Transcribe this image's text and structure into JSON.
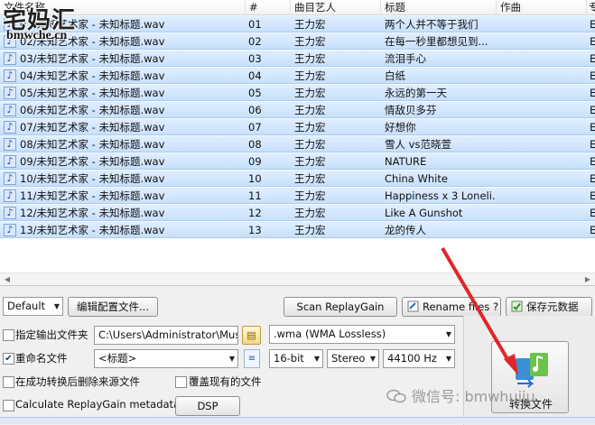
{
  "logo": {
    "main": "宅妈汇",
    "sub": "bmwche.cn"
  },
  "columns": {
    "file": "文件名称",
    "num": "#",
    "artist": "曲目艺人",
    "title": "标题",
    "composer": "作曲",
    "more": "专"
  },
  "rows": [
    {
      "file": "01/未知艺术家 - 未知标题.wav",
      "num": "01",
      "artist": "王力宏",
      "title": "两个人并不等于我们",
      "more": "E"
    },
    {
      "file": "02/未知艺术家 - 未知标题.wav",
      "num": "02",
      "artist": "王力宏",
      "title": "在每一秒里都想见到...",
      "more": "E"
    },
    {
      "file": "03/未知艺术家 - 未知标题.wav",
      "num": "03",
      "artist": "王力宏",
      "title": "流泪手心",
      "more": "E"
    },
    {
      "file": "04/未知艺术家 - 未知标题.wav",
      "num": "04",
      "artist": "王力宏",
      "title": "白纸",
      "more": "E"
    },
    {
      "file": "05/未知艺术家 - 未知标题.wav",
      "num": "05",
      "artist": "王力宏",
      "title": "永远的第一天",
      "more": "E"
    },
    {
      "file": "06/未知艺术家 - 未知标题.wav",
      "num": "06",
      "artist": "王力宏",
      "title": "情敌贝多芬",
      "more": "E"
    },
    {
      "file": "07/未知艺术家 - 未知标题.wav",
      "num": "07",
      "artist": "王力宏",
      "title": "好想你",
      "more": "E"
    },
    {
      "file": "08/未知艺术家 - 未知标题.wav",
      "num": "08",
      "artist": "王力宏",
      "title": "雪人 vs范晓萱",
      "more": "E"
    },
    {
      "file": "09/未知艺术家 - 未知标题.wav",
      "num": "09",
      "artist": "王力宏",
      "title": "NATURE",
      "more": "E"
    },
    {
      "file": "10/未知艺术家 - 未知标题.wav",
      "num": "10",
      "artist": "王力宏",
      "title": "China White",
      "more": "E"
    },
    {
      "file": "11/未知艺术家 - 未知标题.wav",
      "num": "11",
      "artist": "王力宏",
      "title": "Happiness x 3 Loneli...",
      "more": "E"
    },
    {
      "file": "12/未知艺术家 - 未知标题.wav",
      "num": "12",
      "artist": "王力宏",
      "title": "Like A Gunshot",
      "more": "E"
    },
    {
      "file": "13/未知艺术家 - 未知标题.wav",
      "num": "13",
      "artist": "王力宏",
      "title": "龙的传人",
      "more": "E"
    }
  ],
  "toolbar": {
    "profile_select": "Default",
    "edit_profile": "编辑配置文件...",
    "scan_replaygain": "Scan ReplayGain",
    "rename_files": "Rename files ?",
    "save_metadata": "保存元数据"
  },
  "options": {
    "output_folder_label": "指定输出文件夹",
    "output_folder_value": "C:\\Users\\Administrator\\Music",
    "rename_label": "重命名文件",
    "rename_value": "<标题>",
    "delete_source_label": "在成功转换后删除来源文件",
    "overwrite_label": "覆盖现有的文件",
    "replaygain_label": "Calculate ReplayGain metadata",
    "dsp_button": "DSP",
    "output_folder_checked": false,
    "rename_checked": true,
    "delete_source_checked": false,
    "overwrite_checked": false,
    "replaygain_checked": false
  },
  "encoder": {
    "format": ".wma (WMA Lossless)",
    "bitdepth": "16-bit",
    "channels": "Stereo",
    "samplerate": "44100 Hz"
  },
  "convert": {
    "label": "转换文件"
  },
  "watermark": {
    "text": "微信号: bmwhuiju"
  },
  "colors": {
    "row_selected": "#cfe4fb",
    "arrow": "#e0262b"
  }
}
